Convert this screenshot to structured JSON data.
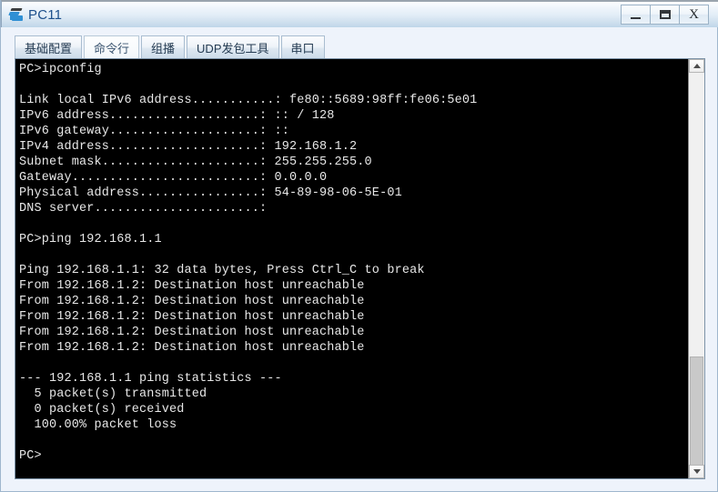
{
  "window": {
    "title": "PC11",
    "icon": "pc-device-icon",
    "buttons": [
      {
        "name": "minimize-button",
        "icon": "minimize-icon",
        "label": "—"
      },
      {
        "name": "maximize-button",
        "icon": "maximize-icon",
        "label": "❐"
      },
      {
        "name": "close-button",
        "icon": "close-icon",
        "label": "X"
      }
    ]
  },
  "tabs": [
    {
      "label": "基础配置",
      "name": "tab-basic-config",
      "active": false
    },
    {
      "label": "命令行",
      "name": "tab-command-line",
      "active": true
    },
    {
      "label": "组播",
      "name": "tab-multicast",
      "active": false
    },
    {
      "label": "UDP发包工具",
      "name": "tab-udp-packet-tool",
      "active": false
    },
    {
      "label": "串口",
      "name": "tab-serial-port",
      "active": false
    }
  ],
  "terminal": {
    "prompt": "PC>",
    "background": "#000000",
    "foreground": "#e8e8e8",
    "lines": [
      "PC>ipconfig",
      "",
      "Link local IPv6 address...........: fe80::5689:98ff:fe06:5e01",
      "IPv6 address....................: :: / 128",
      "IPv6 gateway....................: ::",
      "IPv4 address....................: 192.168.1.2",
      "Subnet mask.....................: 255.255.255.0",
      "Gateway.........................: 0.0.0.0",
      "Physical address................: 54-89-98-06-5E-01",
      "DNS server......................:",
      "",
      "PC>ping 192.168.1.1",
      "",
      "Ping 192.168.1.1: 32 data bytes, Press Ctrl_C to break",
      "From 192.168.1.2: Destination host unreachable",
      "From 192.168.1.2: Destination host unreachable",
      "From 192.168.1.2: Destination host unreachable",
      "From 192.168.1.2: Destination host unreachable",
      "From 192.168.1.2: Destination host unreachable",
      "",
      "--- 192.168.1.1 ping statistics ---",
      "  5 packet(s) transmitted",
      "  0 packet(s) received",
      "  100.00% packet loss",
      "",
      "PC>"
    ],
    "ipconfig": {
      "command": "ipconfig",
      "link_local_ipv6_address": "fe80::5689:98ff:fe06:5e01",
      "ipv6_address": ":: / 128",
      "ipv6_gateway": "::",
      "ipv4_address": "192.168.1.2",
      "subnet_mask": "255.255.255.0",
      "gateway": "0.0.0.0",
      "physical_address": "54-89-98-06-5E-01",
      "dns_server": ""
    },
    "ping": {
      "command": "ping 192.168.1.1",
      "target": "192.168.1.1",
      "data_bytes": "32",
      "break_hint": "Press Ctrl_C to break",
      "reply_source": "192.168.1.2",
      "reply_message": "Destination host unreachable",
      "reply_count": 5,
      "statistics_header": "--- 192.168.1.1 ping statistics ---",
      "transmitted": "5 packet(s) transmitted",
      "received": "0 packet(s) received",
      "packet_loss": "100.00% packet loss"
    }
  },
  "scrollbar": {
    "up_arrow_icon": "chevron-up-icon",
    "down_arrow_icon": "chevron-down-icon",
    "thumb_position": "near-bottom"
  }
}
